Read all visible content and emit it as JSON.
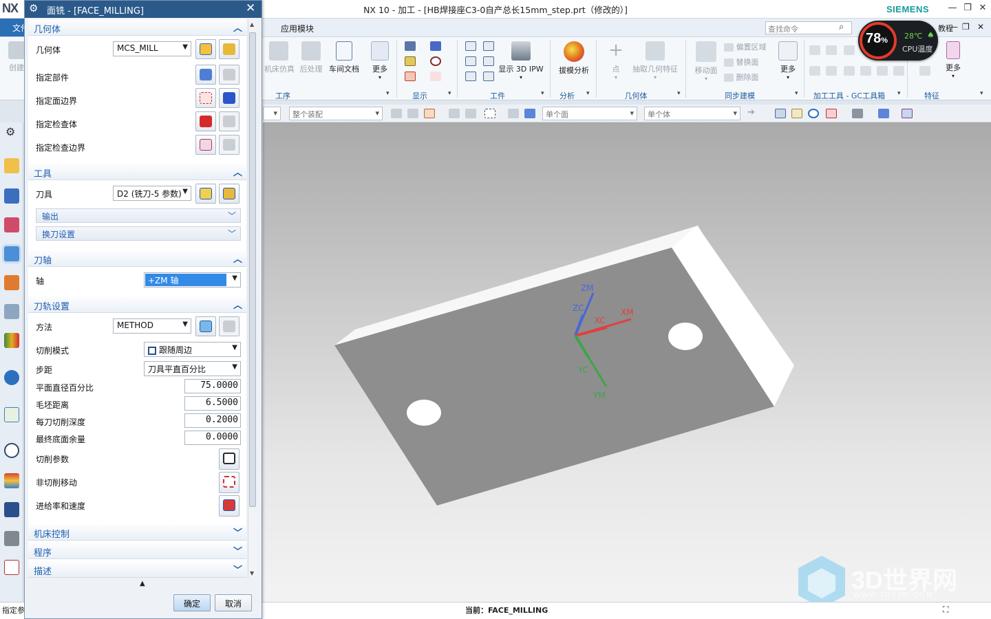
{
  "window": {
    "title": "NX 10 - 加工 - [HB焊接座C3-0自产总长15mm_step.prt（修改的）]",
    "logo": "NX",
    "brand": "SIEMENS",
    "search_placeholder": "查找命令",
    "help_label": "教程"
  },
  "menubar": {
    "file_label": "文件",
    "app_module_label": "应用模块"
  },
  "ribbon": {
    "groups": {
      "operation": "工序",
      "display": "显示",
      "workpiece": "工件",
      "analysis": "分析",
      "geometry": "几何体",
      "sync": "同步建模",
      "gc_tools": "加工工具 - GC工具箱",
      "feature": "特征"
    },
    "buttons": {
      "create": "创建",
      "machine_sim": "机床仿真",
      "post_process": "后处理",
      "shop_doc": "车间文档",
      "more": "更多",
      "show_3d_ipw": "显示 3D IPW",
      "draft_analysis": "拔模分析",
      "point": "点",
      "extract_geometry": "抽取几何特征",
      "move_face": "移动面",
      "offset_region": "偏置区域",
      "replace_face": "替换面",
      "delete_face": "删除面"
    }
  },
  "selection_bar": {
    "assembly_filter": "整个装配",
    "face_rule": "单个面",
    "body_rule": "单个体"
  },
  "cpu_widget": {
    "percent": "78",
    "percent_sign": "%",
    "temperature": "28℃",
    "label": "CPU温度"
  },
  "dialog": {
    "title": "面铣 - [FACE_MILLING]",
    "geometry_section": {
      "header": "几何体",
      "geometry_label": "几何体",
      "geometry_value": "MCS_MILL",
      "specify_part": "指定部件",
      "specify_face_boundary": "指定面边界",
      "specify_check_body": "指定检查体",
      "specify_check_boundary": "指定检查边界"
    },
    "tool_section": {
      "header": "工具",
      "tool_label": "刀具",
      "tool_value": "D2 (铣刀-5 参数)",
      "output_label": "输出",
      "tool_change_label": "换刀设置"
    },
    "axis_section": {
      "header": "刀轴",
      "axis_label": "轴",
      "axis_value": "+ZM 轴"
    },
    "path_section": {
      "header": "刀轨设置",
      "method_label": "方法",
      "method_value": "METHOD",
      "cut_pattern_label": "切削模式",
      "cut_pattern_value": "跟随周边",
      "stepover_label": "步距",
      "stepover_value": "刀具平直百分比",
      "flat_diameter_label": "平面直径百分比",
      "flat_diameter_value": "75.0000",
      "blank_distance_label": "毛坯距离",
      "blank_distance_value": "6.5000",
      "depth_per_cut_label": "每刀切削深度",
      "depth_per_cut_value": "0.2000",
      "final_floor_stock_label": "最终底面余量",
      "final_floor_stock_value": "0.0000",
      "cutting_params_label": "切削参数",
      "non_cutting_label": "非切削移动",
      "feeds_speeds_label": "进给率和速度"
    },
    "collapsed_sections": {
      "machine_control": "机床控制",
      "program": "程序",
      "description": "描述"
    },
    "ok_label": "确定",
    "cancel_label": "取消"
  },
  "viewport": {
    "axis_labels": {
      "zm": "ZM",
      "zc": "ZC",
      "xc": "XC",
      "xm": "XM",
      "yc": "YC",
      "ym": "YM"
    }
  },
  "status": {
    "left_prompt": "指定参",
    "current_op": "当前：FACE_MILLING"
  },
  "watermark": {
    "text": "3D世界网",
    "url": "WWW.3DSJW.COM"
  },
  "colors": {
    "dialog_header_blue": "#2b5a8a",
    "section_text_blue": "#1d5fae",
    "part_top_gray": "#8e8e8e",
    "axis_red": "#e04040",
    "axis_green": "#3da54a",
    "axis_blue": "#4a67d8"
  }
}
